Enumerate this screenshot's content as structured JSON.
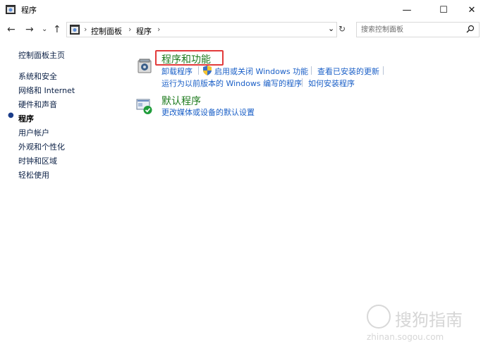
{
  "window": {
    "title": "程序",
    "controls": {
      "minimize": "—",
      "maximize": "☐",
      "close": "✕"
    }
  },
  "nav": {
    "back": "←",
    "forward": "→",
    "recent": "⌄",
    "up": "↑",
    "breadcrumbs": [
      "控制面板",
      "程序"
    ],
    "crumb_separator": "›",
    "dropdown": "⌄",
    "refresh": "↻"
  },
  "search": {
    "placeholder": "搜索控制面板"
  },
  "sidebar": {
    "home": "控制面板主页",
    "items": [
      {
        "label": "系统和安全"
      },
      {
        "label": "网络和 Internet"
      },
      {
        "label": "硬件和声音"
      },
      {
        "label": "程序",
        "active": true
      },
      {
        "label": "用户帐户"
      },
      {
        "label": "外观和个性化"
      },
      {
        "label": "时钟和区域"
      },
      {
        "label": "轻松使用"
      }
    ]
  },
  "categories": {
    "programs_features": {
      "title": "程序和功能",
      "links": [
        "卸载程序",
        "启用或关闭 Windows 功能",
        "查看已安装的更新",
        "运行为以前版本的 Windows 编写的程序",
        "如何安装程序"
      ]
    },
    "default_programs": {
      "title": "默认程序",
      "links": [
        "更改媒体或设备的默认设置"
      ]
    }
  },
  "watermark": {
    "text": "搜狗指南",
    "url": "zhinan.sogou.com"
  },
  "colors": {
    "link": "#1a5fc7",
    "category_title": "#1c7a1c",
    "highlight": "#e23b3b"
  }
}
